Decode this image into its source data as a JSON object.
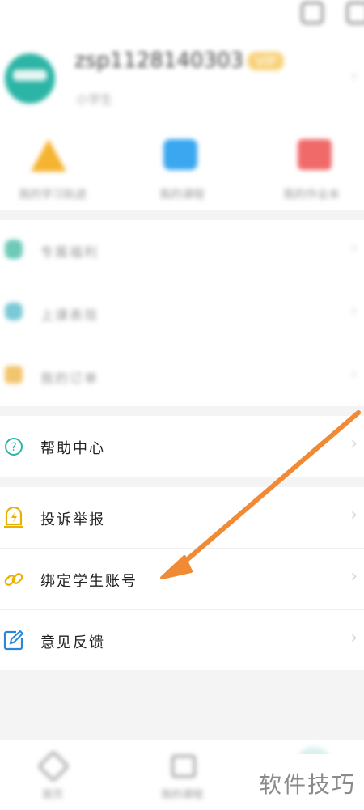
{
  "header": {
    "username": "zsp1128140303",
    "vip_badge": "VIP",
    "subtitle": "小学生"
  },
  "quick_actions": [
    {
      "label": "我的学习轨迹",
      "icon": "triangle-icon",
      "color": "#f5b430"
    },
    {
      "label": "我的课程",
      "icon": "chat-icon",
      "color": "#3aa7f0"
    },
    {
      "label": "我的作业本",
      "icon": "book-icon",
      "color": "#f06a6a"
    }
  ],
  "blurred_menu": [
    {
      "label": "专属福利",
      "color": "#6ec9b8"
    },
    {
      "label": "上课表现",
      "color": "#7ac9d6"
    },
    {
      "label": "我的订单",
      "color": "#f1c56b"
    }
  ],
  "menu": {
    "help": "帮助中心",
    "complaint": "投诉举报",
    "bind_student": "绑定学生账号",
    "feedback": "意见反馈"
  },
  "bottom_nav": [
    {
      "label": "首页",
      "icon": "home-icon"
    },
    {
      "label": "我的课程",
      "icon": "course-icon"
    }
  ],
  "watermark": "软件技巧",
  "colors": {
    "accent_teal": "#2bb5a6",
    "accent_yellow": "#e8b000",
    "accent_blue": "#2b86d8",
    "arrow": "#f08a35"
  }
}
